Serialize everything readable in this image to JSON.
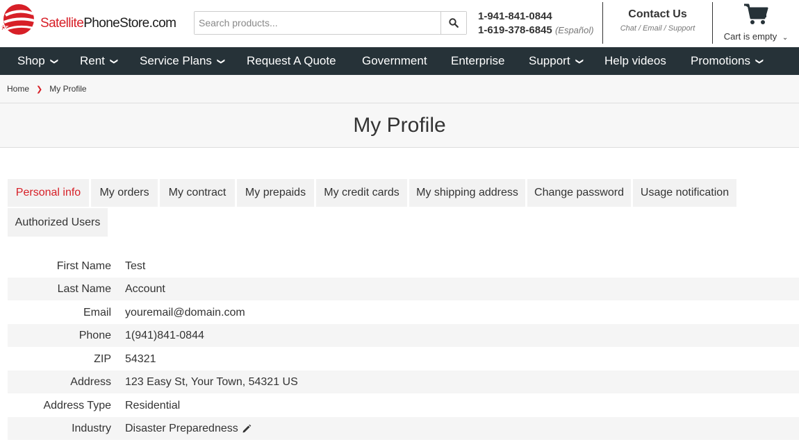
{
  "brand": {
    "logo_part1": "Satellite",
    "logo_part2": "PhoneStore",
    "logo_part3": ".com"
  },
  "search": {
    "placeholder": "Search products..."
  },
  "phones": {
    "line1": "1-941-841-0844",
    "line2": "1-619-378-6845",
    "espanol": "(Español)"
  },
  "contact": {
    "title": "Contact Us",
    "subtitle": "Chat / Email / Support"
  },
  "cart": {
    "label": "Cart is empty"
  },
  "nav": {
    "shop": "Shop",
    "rent": "Rent",
    "service_plans": "Service Plans",
    "request_quote": "Request A Quote",
    "government": "Government",
    "enterprise": "Enterprise",
    "support": "Support",
    "help_videos": "Help videos",
    "promotions": "Promotions"
  },
  "breadcrumb": {
    "home": "Home",
    "current": "My Profile"
  },
  "page": {
    "title": "My Profile"
  },
  "tabs": {
    "personal_info": "Personal info",
    "my_orders": "My orders",
    "my_contract": "My contract",
    "my_prepaids": "My prepaids",
    "my_credit_cards": "My credit cards",
    "my_shipping_address": "My shipping address",
    "change_password": "Change password",
    "usage_notification": "Usage notification",
    "authorized_users": "Authorized Users"
  },
  "profile": [
    {
      "label": "First Name",
      "value": "Test"
    },
    {
      "label": "Last Name",
      "value": "Account"
    },
    {
      "label": "Email",
      "value": "youremail@domain.com"
    },
    {
      "label": "Phone",
      "value": "1(941)841-0844"
    },
    {
      "label": "ZIP",
      "value": "54321"
    },
    {
      "label": "Address",
      "value": "123 Easy St, Your Town, 54321 US"
    },
    {
      "label": "Address Type",
      "value": "Residential"
    },
    {
      "label": "Industry",
      "value": "Disaster Preparedness"
    }
  ],
  "colors": {
    "brand_red": "#d71f27",
    "nav_bg": "#263238"
  }
}
